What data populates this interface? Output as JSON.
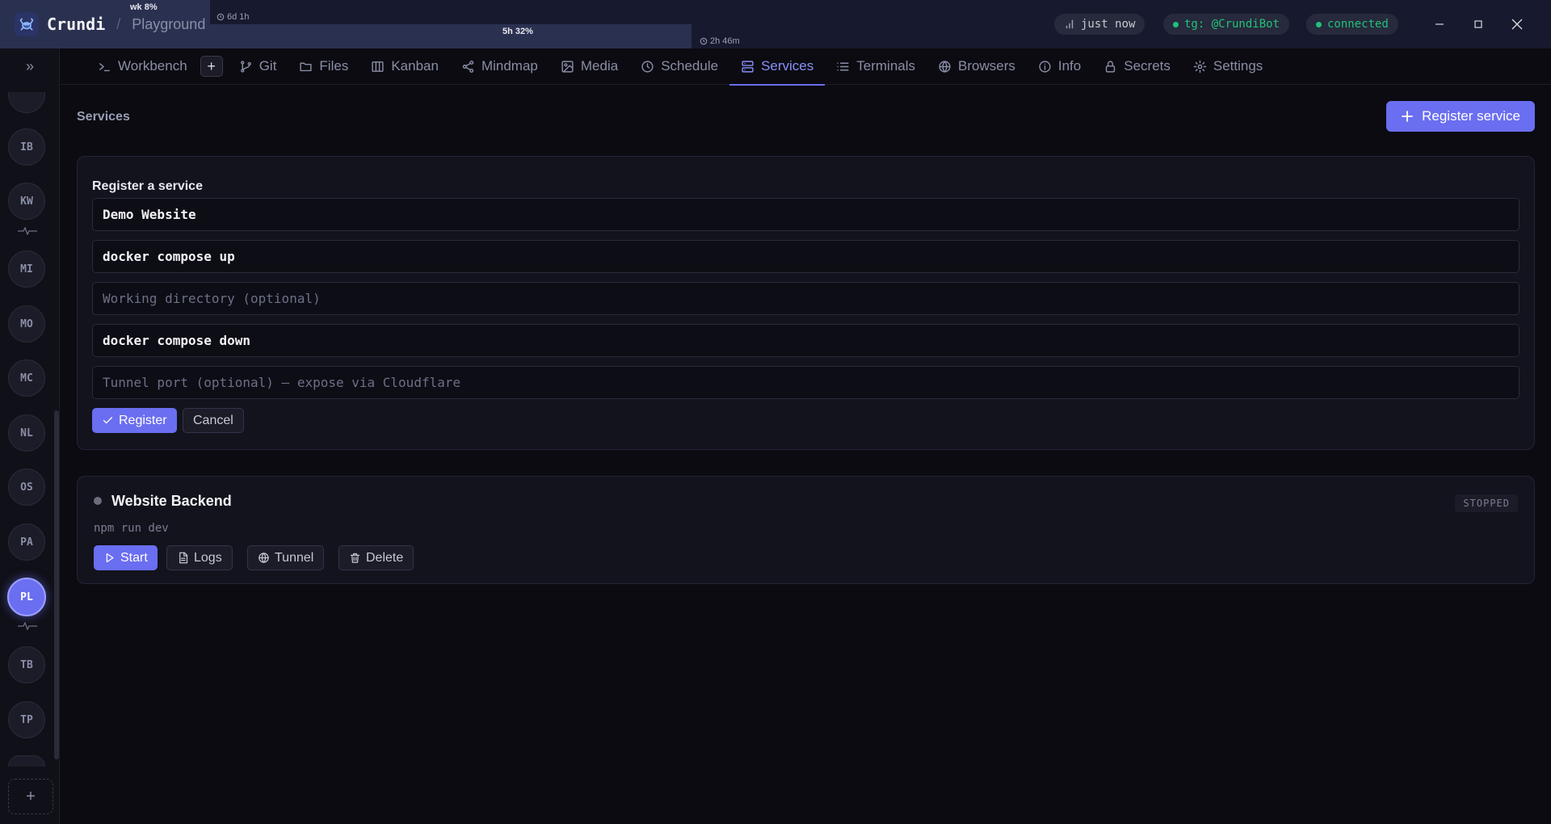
{
  "app": {
    "name": "Crundi",
    "separator": "/",
    "project": "Playground"
  },
  "usage": {
    "weekly_label": "wk 8%",
    "weekly_percent": 8,
    "weekly_reset": "6d 1h",
    "session_label": "5h 32%",
    "session_percent": 32,
    "session_reset": "2h 46m"
  },
  "status": {
    "sync": "just now",
    "telegram": "tg: @CrundiBot",
    "connection": "connected",
    "connected_color": "#22c07a",
    "telegram_color": "#22c07a"
  },
  "rail": {
    "items": [
      {
        "label": "IB"
      },
      {
        "label": "KW"
      },
      {
        "label": "MI"
      },
      {
        "label": "MO"
      },
      {
        "label": "MC"
      },
      {
        "label": "NL"
      },
      {
        "label": "OS"
      },
      {
        "label": "PA"
      },
      {
        "label": "PL",
        "active": true
      },
      {
        "label": "TB"
      },
      {
        "label": "TP"
      }
    ],
    "add_label": "+"
  },
  "tabs": [
    {
      "label": "Workbench",
      "icon": "terminal-prompt-icon"
    },
    {
      "label": "Git",
      "icon": "git-branch-icon"
    },
    {
      "label": "Files",
      "icon": "folder-icon"
    },
    {
      "label": "Kanban",
      "icon": "columns-icon"
    },
    {
      "label": "Mindmap",
      "icon": "share-nodes-icon"
    },
    {
      "label": "Media",
      "icon": "images-icon"
    },
    {
      "label": "Schedule",
      "icon": "clock-icon"
    },
    {
      "label": "Services",
      "icon": "server-icon",
      "active": true
    },
    {
      "label": "Terminals",
      "icon": "list-icon"
    },
    {
      "label": "Browsers",
      "icon": "globe-icon"
    },
    {
      "label": "Info",
      "icon": "info-icon"
    },
    {
      "label": "Secrets",
      "icon": "lock-icon"
    },
    {
      "label": "Settings",
      "icon": "gear-icon"
    }
  ],
  "tab_add_label": "+",
  "main": {
    "title": "Services",
    "register_button": "Register service"
  },
  "form": {
    "title": "Register a service",
    "name_value": "Demo Website",
    "name_placeholder": "",
    "start_value": "docker compose up",
    "start_placeholder": "",
    "workdir_value": "",
    "workdir_placeholder": "Working directory (optional)",
    "stop_value": "docker compose down",
    "stop_placeholder": "",
    "tunnel_value": "",
    "tunnel_placeholder": "Tunnel port (optional) — expose via Cloudflare",
    "submit_label": "Register",
    "cancel_label": "Cancel"
  },
  "service": {
    "name": "Website Backend",
    "command": "npm run dev",
    "status": "STOPPED",
    "actions": {
      "start": "Start",
      "logs": "Logs",
      "tunnel": "Tunnel",
      "delete": "Delete"
    }
  },
  "colors": {
    "accent": "#6a6ef0",
    "titlebar": "#171a2e",
    "background": "#0b0b11"
  }
}
